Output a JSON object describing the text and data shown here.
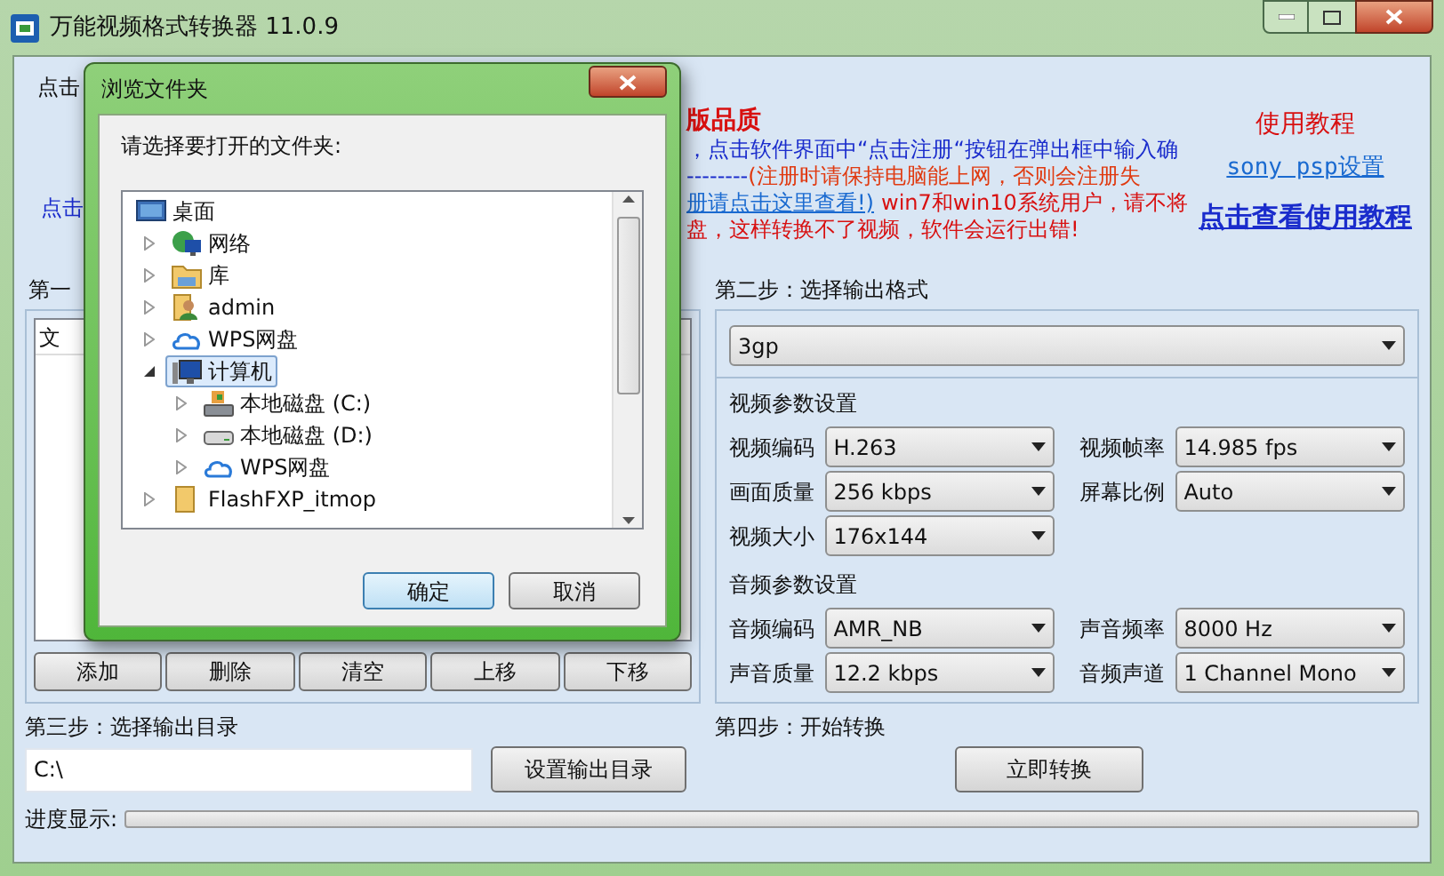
{
  "window": {
    "title": "万能视频格式转换器 11.0.9"
  },
  "header": {
    "left_label": "点击",
    "left_link": "点击",
    "headline": "版品质",
    "line_1": "，点击软件界面中“点击注册“按钮在弹出框中输入确",
    "line_2_dashes": "--------",
    "line_2_warning": "(注册时请保持电脑能上网，否则会注册失",
    "line_3_link": "册请点击这里查看!)",
    "line_3_warning": "win7和win10系统用户，请不将",
    "line_4_warning": "盘，这样转换不了视频，软件会运行出错!",
    "tutorial_title": "使用教程",
    "psp_link": "sony psp设置",
    "tutorial_link": "点击查看使用教程"
  },
  "step1": {
    "label": "第一",
    "list_header": "文",
    "buttons": [
      "添加",
      "删除",
      "清空",
      "上移",
      "下移"
    ]
  },
  "step2": {
    "label": "第二步：选择输出格式",
    "format": "3gp",
    "video_title": "视频参数设置",
    "video_params": [
      {
        "label": "视频编码",
        "value": "H.263"
      },
      {
        "label": "视频帧率",
        "value": "14.985 fps"
      },
      {
        "label": "画面质量",
        "value": "256 kbps"
      },
      {
        "label": "屏幕比例",
        "value": "Auto"
      },
      {
        "label": "视频大小",
        "value": "176x144"
      }
    ],
    "audio_title": "音频参数设置",
    "audio_params": [
      {
        "label": "音频编码",
        "value": "AMR_NB"
      },
      {
        "label": "声音频率",
        "value": "8000 Hz"
      },
      {
        "label": "声音质量",
        "value": "12.2 kbps"
      },
      {
        "label": "音频声道",
        "value": "1 Channel Mono"
      }
    ]
  },
  "step3": {
    "label": "第三步：选择输出目录",
    "path": "C:\\",
    "button": "设置输出目录"
  },
  "step4": {
    "label": "第四步：开始转换",
    "button": "立即转换"
  },
  "progress": {
    "label": "进度显示:",
    "level": 0
  },
  "dialog": {
    "title": "浏览文件夹",
    "prompt": "请选择要打开的文件夹:",
    "tree": [
      {
        "label": "桌面",
        "kind": "desktop",
        "selected": false,
        "children": [
          {
            "label": "网络",
            "kind": "network",
            "expanded": false,
            "selected": false
          },
          {
            "label": "库",
            "kind": "library",
            "expanded": false,
            "selected": false
          },
          {
            "label": "admin",
            "kind": "user",
            "expanded": false,
            "selected": false
          },
          {
            "label": "WPS网盘",
            "kind": "cloud",
            "expanded": false,
            "selected": false
          },
          {
            "label": "计算机",
            "kind": "computer",
            "expanded": true,
            "selected": true,
            "children": [
              {
                "label": "本地磁盘 (C:)",
                "kind": "system-disk",
                "expanded": false,
                "selected": false
              },
              {
                "label": "本地磁盘 (D:)",
                "kind": "disk",
                "expanded": false,
                "selected": false
              },
              {
                "label": "WPS网盘",
                "kind": "cloud",
                "expanded": false,
                "selected": false
              }
            ]
          },
          {
            "label": "FlashFXP_itmop",
            "kind": "folder",
            "expanded": false,
            "selected": false
          }
        ]
      }
    ],
    "buttons": [
      {
        "label": "确定",
        "default": true
      },
      {
        "label": "取消",
        "default": false
      }
    ]
  }
}
